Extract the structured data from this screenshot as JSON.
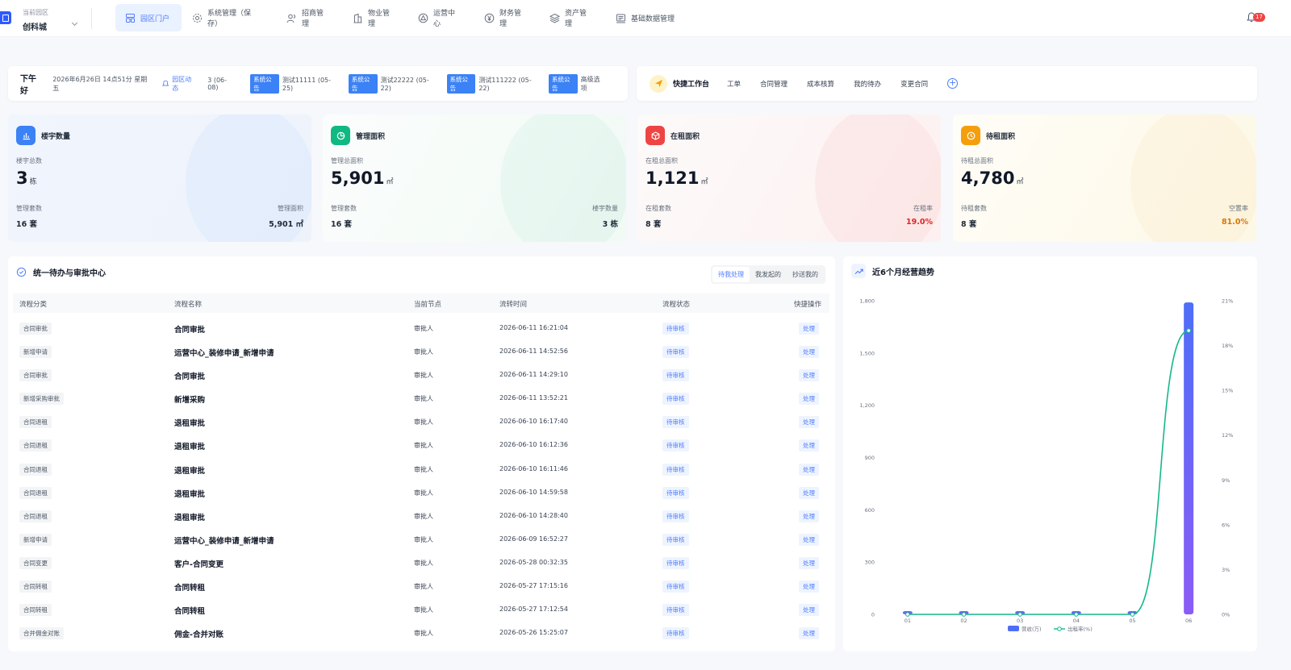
{
  "park": {
    "label": "当前园区",
    "name": "创科城"
  },
  "nav": [
    {
      "label": "园区门户",
      "icon": "dashboard-icon",
      "active": true
    },
    {
      "label": "系统管理（保存）",
      "icon": "gear-icon"
    },
    {
      "label": "招商管理",
      "icon": "users-icon"
    },
    {
      "label": "物业管理",
      "icon": "building-icon"
    },
    {
      "label": "运营中心",
      "icon": "triangle-icon"
    },
    {
      "label": "财务管理",
      "icon": "yen-icon"
    },
    {
      "label": "资产管理",
      "icon": "layers-icon"
    },
    {
      "label": "基础数据管理",
      "icon": "data-icon"
    }
  ],
  "notifications": {
    "count": "17"
  },
  "announcement": {
    "greeting": "下午好",
    "datetime": "2026年6月26日 14点51分 星期五",
    "dynamics_label": "园区动态",
    "dynamics_count": "3 (06-08)",
    "items": [
      {
        "tag": "系统公告",
        "text": "测试11111 (05-25)"
      },
      {
        "tag": "系统公告",
        "text": "测试22222 (05-22)"
      },
      {
        "tag": "系统公告",
        "text": "测试111222 (05-22)"
      },
      {
        "tag": "系统公告",
        "text": "高级选项"
      }
    ]
  },
  "quick": {
    "title": "快捷工作台",
    "links": [
      "工单",
      "合同管理",
      "成本核算",
      "我的待办",
      "变更合同"
    ],
    "add": "+"
  },
  "stats": [
    {
      "title": "楼宇数量",
      "sub": "楼宇总数",
      "value": "3",
      "unit": "栋",
      "left_label": "管理套数",
      "left_value": "16 套",
      "right_label": "管理面积",
      "right_value": "5,901 ㎡",
      "color": "#3b82f6",
      "icon": "bar-chart-icon"
    },
    {
      "title": "管理面积",
      "sub": "管理总面积",
      "value": "5,901",
      "unit": "㎡",
      "left_label": "管理套数",
      "left_value": "16 套",
      "right_label": "楼宇数量",
      "right_value": "3 栋",
      "color": "#10b981",
      "icon": "pie-icon"
    },
    {
      "title": "在租面积",
      "sub": "在租总面积",
      "value": "1,121",
      "unit": "㎡",
      "left_label": "在租套数",
      "left_value": "8 套",
      "right_label": "在租率",
      "right_value": "19.0%",
      "right_color": "#dc2626",
      "color": "#ef4444",
      "icon": "box-icon"
    },
    {
      "title": "待租面积",
      "sub": "待租总面积",
      "value": "4,780",
      "unit": "㎡",
      "left_label": "待租套数",
      "left_value": "8 套",
      "right_label": "空置率",
      "right_value": "81.0%",
      "right_color": "#d97706",
      "color": "#f59e0b",
      "icon": "clock-icon"
    }
  ],
  "todo": {
    "title": "统一待办与审批中心",
    "tabs": [
      "待我处理",
      "我发起的",
      "抄送我的"
    ],
    "columns": [
      "流程分类",
      "流程名称",
      "当前节点",
      "流转时间",
      "流程状态",
      "快捷操作"
    ],
    "rows": [
      {
        "cat": "合同审批",
        "name": "合同审批",
        "node": "审批人",
        "time": "2026-06-11 16:21:04",
        "status": "待审核",
        "action": "处理"
      },
      {
        "cat": "新增申请",
        "name": "运营中心_装修申请_新增申请",
        "node": "审批人",
        "time": "2026-06-11 14:52:56",
        "status": "待审核",
        "action": "处理"
      },
      {
        "cat": "合同审批",
        "name": "合同审批",
        "node": "审批人",
        "time": "2026-06-11 14:29:10",
        "status": "待审核",
        "action": "处理"
      },
      {
        "cat": "新增采购审批",
        "name": "新增采购",
        "node": "审批人",
        "time": "2026-06-11 13:52:21",
        "status": "待审核",
        "action": "处理"
      },
      {
        "cat": "合同退租",
        "name": "退租审批",
        "node": "审批人",
        "time": "2026-06-10 16:17:40",
        "status": "待审核",
        "action": "处理"
      },
      {
        "cat": "合同退租",
        "name": "退租审批",
        "node": "审批人",
        "time": "2026-06-10 16:12:36",
        "status": "待审核",
        "action": "处理"
      },
      {
        "cat": "合同退租",
        "name": "退租审批",
        "node": "审批人",
        "time": "2026-06-10 16:11:46",
        "status": "待审核",
        "action": "处理"
      },
      {
        "cat": "合同退租",
        "name": "退租审批",
        "node": "审批人",
        "time": "2026-06-10 14:59:58",
        "status": "待审核",
        "action": "处理"
      },
      {
        "cat": "合同退租",
        "name": "退租审批",
        "node": "审批人",
        "time": "2026-06-10 14:28:40",
        "status": "待审核",
        "action": "处理"
      },
      {
        "cat": "新增申请",
        "name": "运营中心_装修申请_新增申请",
        "node": "审批人",
        "time": "2026-06-09 16:52:27",
        "status": "待审核",
        "action": "处理"
      },
      {
        "cat": "合同变更",
        "name": "客户-合同变更",
        "node": "审批人",
        "time": "2026-05-28 00:32:35",
        "status": "待审核",
        "action": "处理"
      },
      {
        "cat": "合同转租",
        "name": "合同转租",
        "node": "审批人",
        "time": "2026-05-27 17:15:16",
        "status": "待审核",
        "action": "处理"
      },
      {
        "cat": "合同转租",
        "name": "合同转租",
        "node": "审批人",
        "time": "2026-05-27 17:12:54",
        "status": "待审核",
        "action": "处理"
      },
      {
        "cat": "合并佣金对账",
        "name": "佣金-合并对账",
        "node": "审批人",
        "time": "2026-05-26 15:25:07",
        "status": "待审核",
        "action": "处理"
      }
    ]
  },
  "trend": {
    "title": "近6个月经营趋势"
  },
  "chart_data": {
    "type": "bar",
    "categories": [
      "01",
      "02",
      "03",
      "04",
      "05",
      "06"
    ],
    "series": [
      {
        "name": "营收(万)",
        "kind": "bar",
        "axis": "left",
        "values": [
          0,
          15,
          10,
          8,
          10,
          1790
        ],
        "color": "#4f6ef7"
      },
      {
        "name": "出租率(%)",
        "kind": "line",
        "axis": "right",
        "values": [
          0,
          0,
          0,
          0,
          0,
          19.0
        ],
        "color": "#14b88a"
      }
    ],
    "y_left": {
      "min": 0,
      "max": 1800,
      "ticks": [
        0,
        300,
        600,
        900,
        1200,
        1500,
        1800
      ],
      "tick_labels": [
        "0",
        "300",
        "600",
        "900",
        "1,200",
        "1,500",
        "1,800"
      ]
    },
    "y_right": {
      "min": 0,
      "max": 21,
      "ticks": [
        0,
        3,
        6,
        9,
        12,
        15,
        18,
        21
      ],
      "tick_labels": [
        "0%",
        "3%",
        "6%",
        "9%",
        "12%",
        "15%",
        "18%",
        "21%"
      ]
    },
    "legend": "bottom-center"
  }
}
